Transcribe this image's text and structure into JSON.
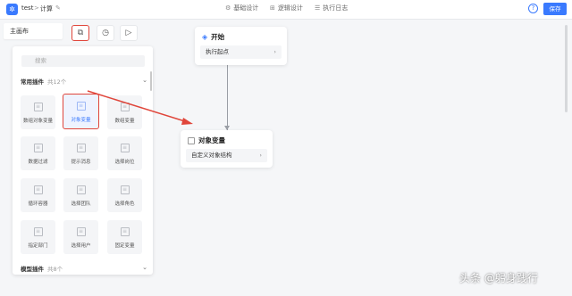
{
  "header": {
    "logo_glyph": "✲",
    "breadcrumb_app": "test",
    "breadcrumb_sep": ">",
    "breadcrumb_page": "计算",
    "tabs": [
      {
        "icon": "⚙",
        "label": "基础设计"
      },
      {
        "icon": "⊞",
        "label": "逻辑设计"
      },
      {
        "icon": "☰",
        "label": "执行日志"
      }
    ],
    "help_glyph": "?",
    "save_label": "保存"
  },
  "canvas_tab": {
    "label": "主画布"
  },
  "tools": [
    {
      "icon": "box-icon",
      "glyph": "⧉"
    },
    {
      "icon": "clock-icon",
      "glyph": "◷"
    },
    {
      "icon": "play-icon",
      "glyph": "▷"
    }
  ],
  "panel": {
    "search_placeholder": "搜索",
    "common": {
      "title": "常用插件",
      "count": "共12个"
    },
    "model": {
      "title": "模型插件",
      "count": "共8个"
    },
    "plugins": [
      "数组对象变量",
      "对象变量",
      "数组变量",
      "数据过滤",
      "提示消息",
      "选择岗位",
      "循环容器",
      "选择团队",
      "选择角色",
      "指定部门",
      "选择用户",
      "固定变量"
    ]
  },
  "nodes": {
    "start": {
      "title": "开始",
      "row": "执行起点"
    },
    "object_var": {
      "title": "对象变量",
      "row": "自定义对象结构"
    }
  },
  "watermark": "头条 @躬身践行",
  "colors": {
    "accent": "#3a7afe",
    "highlight": "#e0463b"
  }
}
